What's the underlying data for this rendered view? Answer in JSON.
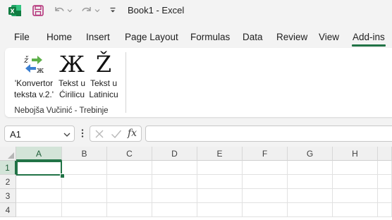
{
  "titlebar": {
    "app_icon": "excel-logo-icon",
    "title": "Book1  -  Excel",
    "quick_access": [
      "save-icon",
      "undo-icon",
      "redo-icon",
      "customize-qat-icon"
    ]
  },
  "tabs": [
    "File",
    "Home",
    "Insert",
    "Page Layout",
    "Formulas",
    "Data",
    "Review",
    "View",
    "Add-ins"
  ],
  "active_tab": "Add-ins",
  "ribbon": {
    "buttons": [
      {
        "icon": "converter-icon",
        "line1": "'Konvertor",
        "line2": "teksta v.2.'"
      },
      {
        "icon": "cyrillic-zhe-icon",
        "glyph": "Ж",
        "line1": "Tekst u",
        "line2": "Ćirilicu"
      },
      {
        "icon": "latin-zcaron-icon",
        "glyph": "Ž",
        "line1": "Tekst u",
        "line2": "Latinicu"
      }
    ],
    "group_label": "Nebojša Vučinić - Trebinje"
  },
  "formula_bar": {
    "name_box": "A1",
    "fx_label": "fx",
    "formula": ""
  },
  "grid": {
    "columns": [
      "A",
      "B",
      "C",
      "D",
      "E",
      "F",
      "G",
      "H"
    ],
    "rows": [
      "1",
      "2",
      "3",
      "4"
    ],
    "active_cell": "A1"
  },
  "colors": {
    "accent": "#217346",
    "header_selected": "#d3e4d8",
    "ribbon_bg": "#ffffff",
    "chrome_bg": "#f3f3f3"
  }
}
